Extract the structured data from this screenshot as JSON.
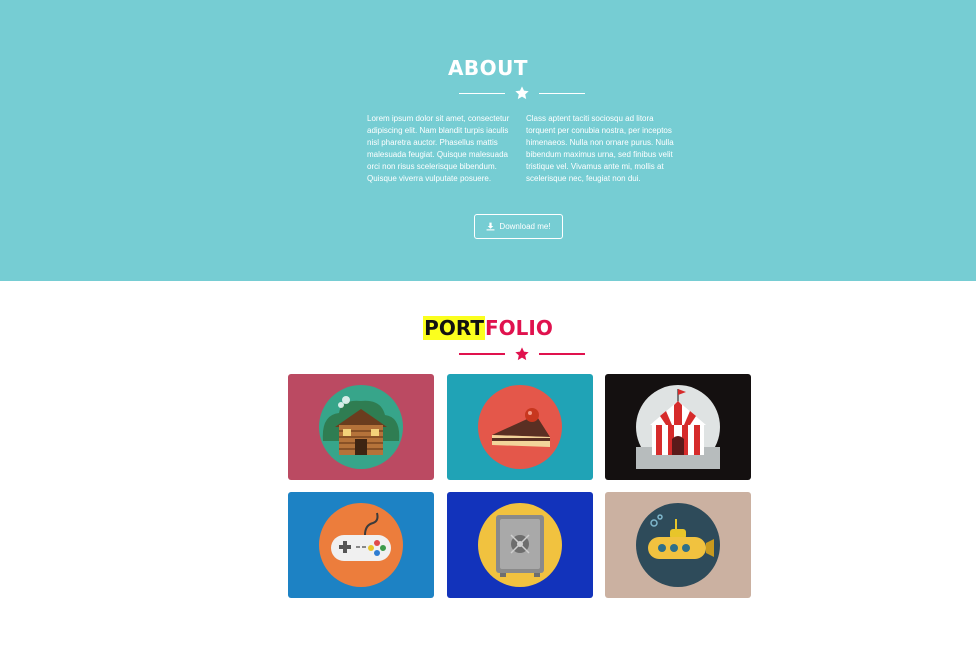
{
  "about": {
    "title": "ABOUT",
    "text_left": "Lorem ipsum dolor sit amet, consectetur adipiscing elit. Nam blandit turpis iaculis nisl pharetra auctor. Phasellus mattis malesuada feugiat. Quisque malesuada orci non risus scelerisque bibendum. Quisque viverra vulputate posuere.",
    "text_right": "Class aptent taciti sociosqu ad litora torquent per conubia nostra, per inceptos himenaeos. Nulla non ornare purus. Nulla bibendum maximus urna, sed finibus velit tristique vel. Vivamus ante mi, mollis at scelerisque nec, feugiat non dui.",
    "button_label": "Download me!",
    "button_icon": "download-icon",
    "background": "#76cdd3"
  },
  "portfolio": {
    "title_highlight": "PORT",
    "title_rest": "FOLIO",
    "accent": "#e0124e",
    "highlight_color": "#fbff1e",
    "items": [
      {
        "icon": "cabin-icon",
        "bg": "#bb4a62"
      },
      {
        "icon": "cake-icon",
        "bg": "#20a3b6"
      },
      {
        "icon": "circus-tent-icon",
        "bg": "#141010"
      },
      {
        "icon": "gamepad-icon",
        "bg": "#1d82c4"
      },
      {
        "icon": "safe-icon",
        "bg": "#1233bb"
      },
      {
        "icon": "submarine-icon",
        "bg": "#cbb1a1"
      }
    ]
  }
}
